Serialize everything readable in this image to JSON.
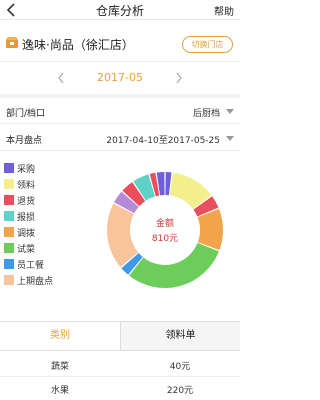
{
  "header": {
    "title": "仓库分析",
    "help_label": "帮助"
  },
  "store": {
    "name": "逸味·尚品（徐汇店）",
    "switch_label": "切换门店"
  },
  "month": {
    "value": "2017-05"
  },
  "filters": {
    "department": {
      "label": "部门/档口",
      "value": "后厨档"
    },
    "period": {
      "label": "本月盘点",
      "value": "2017-04-10至2017-05-25"
    }
  },
  "legend": [
    {
      "label": "采购",
      "color": "#6f5fd8"
    },
    {
      "label": "领料",
      "color": "#f2ef8c"
    },
    {
      "label": "退货",
      "color": "#e84e5c"
    },
    {
      "label": "报损",
      "color": "#5fd1c6"
    },
    {
      "label": "调拨",
      "color": "#f3a34b"
    },
    {
      "label": "试菜",
      "color": "#6ccd5a"
    },
    {
      "label": "员工餐",
      "color": "#3f98e8"
    },
    {
      "label": "上期盘点",
      "color": "#f7c49b"
    }
  ],
  "chart_data": {
    "type": "pie",
    "center_label": "金额",
    "center_value": "810元",
    "slices": [
      {
        "name": "采购",
        "value": 16,
        "color": "#6f5fd8"
      },
      {
        "name": "领料",
        "value": 105,
        "color": "#f2ef8c"
      },
      {
        "name": "退货",
        "value": 32,
        "color": "#e84e5c"
      },
      {
        "name": "调拨",
        "value": 97,
        "color": "#f3a34b"
      },
      {
        "name": "试菜",
        "value": 243,
        "color": "#6ccd5a"
      },
      {
        "name": "员工餐",
        "value": 24,
        "color": "#3f98e8"
      },
      {
        "name": "上期盘点",
        "value": 154,
        "color": "#f7c49b"
      },
      {
        "name": "",
        "value": 32,
        "color": "#b58ad8"
      },
      {
        "name": "退货",
        "value": 32,
        "color": "#e84e5c"
      },
      {
        "name": "报损",
        "value": 40,
        "color": "#5fd1c6"
      },
      {
        "name": "退货",
        "value": 16,
        "color": "#e84e5c"
      },
      {
        "name": "采购",
        "value": 20,
        "color": "#6f5fd8"
      }
    ]
  },
  "tabs": [
    {
      "label": "类别"
    },
    {
      "label": "领料单"
    }
  ],
  "table": [
    {
      "category": "蔬菜",
      "amount": "40元"
    },
    {
      "category": "水果",
      "amount": "220元"
    }
  ]
}
